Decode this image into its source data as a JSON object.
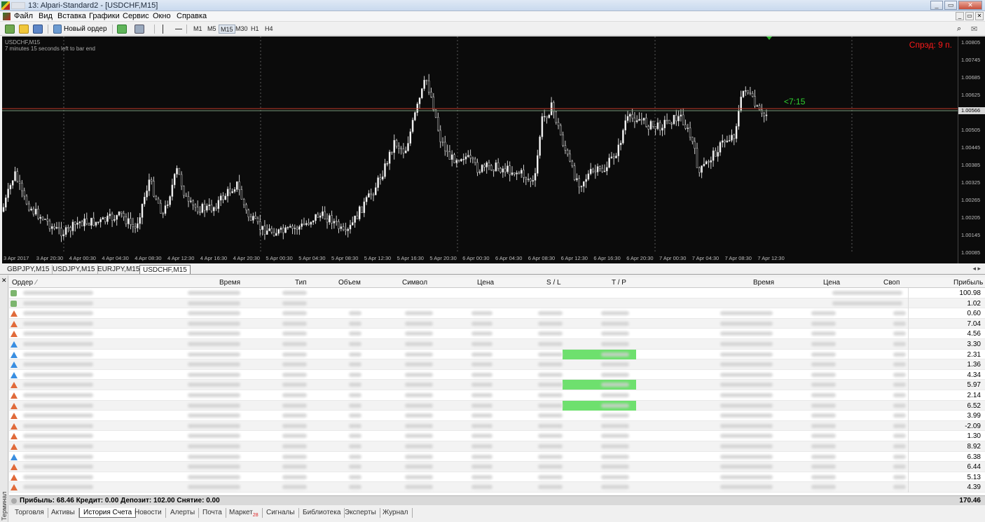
{
  "window": {
    "title": "13: Alpari-Standard2 - [USDCHF,M15]",
    "controls": [
      "_",
      "▭",
      "✕"
    ],
    "mdi_controls": [
      "_",
      "▭",
      "✕"
    ]
  },
  "menu": [
    "Файл",
    "Вид",
    "Вставка",
    "Графики",
    "Сервис",
    "Окно",
    "Справка"
  ],
  "toolbar": {
    "new_order_label": "Новый ордер",
    "timeframes": [
      "M1",
      "M5",
      "M15",
      "M30",
      "H1",
      "H4"
    ],
    "active_timeframe": "M15"
  },
  "chart": {
    "symbol_label": "USDCHF,M15",
    "timer_text": "7 minutes 15 seconds left to bar end",
    "spread_text": "Спрэд: 9 п.",
    "countdown_text": "<7:15",
    "current_price": "1.00566",
    "price_ticks": [
      "1.00805",
      "1.00745",
      "1.00685",
      "1.00625",
      "1.00566",
      "1.00505",
      "1.00445",
      "1.00385",
      "1.00325",
      "1.00265",
      "1.00205",
      "1.00145",
      "1.00085"
    ],
    "time_ticks": [
      "3 Apr 2017",
      "3 Apr 20:30",
      "4 Apr 00:30",
      "4 Apr 04:30",
      "4 Apr 08:30",
      "4 Apr 12:30",
      "4 Apr 16:30",
      "4 Apr 20:30",
      "5 Apr 00:30",
      "5 Apr 04:30",
      "5 Apr 08:30",
      "5 Apr 12:30",
      "5 Apr 16:30",
      "5 Apr 20:30",
      "6 Apr 00:30",
      "6 Apr 04:30",
      "6 Apr 08:30",
      "6 Apr 12:30",
      "6 Apr 16:30",
      "6 Apr 20:30",
      "7 Apr 00:30",
      "7 Apr 04:30",
      "7 Apr 08:30",
      "7 Apr 12:30"
    ],
    "colors": {
      "background": "#0b0b0b",
      "candles": "#d0d0d0",
      "spread": "#ff1a1a",
      "countdown": "#2fd12f"
    }
  },
  "chart_tabs": [
    "GBPJPY,M15",
    "USDJPY,M15",
    "EURJPY,M15",
    "USDCHF,M15"
  ],
  "active_chart_tab": "USDCHF,M15",
  "terminal": {
    "side_label": "Терминал",
    "columns": [
      "Ордер",
      "Время",
      "Тип",
      "Объем",
      "Символ",
      "Цена",
      "S / L",
      "T / P",
      "Время",
      "Цена",
      "Своп",
      "Прибыль"
    ],
    "rows": [
      {
        "type": "balance",
        "profit": "100.98"
      },
      {
        "type": "balance",
        "profit": "1.02"
      },
      {
        "type": "sell",
        "profit": "0.60"
      },
      {
        "type": "sell",
        "profit": "7.04"
      },
      {
        "type": "sell",
        "profit": "4.56"
      },
      {
        "type": "buy",
        "profit": "3.30"
      },
      {
        "type": "buy",
        "profit": "2.31",
        "tp_hit": true
      },
      {
        "type": "buy",
        "profit": "1.36"
      },
      {
        "type": "buy",
        "profit": "4.34"
      },
      {
        "type": "sell",
        "profit": "5.97",
        "tp_hit": true
      },
      {
        "type": "sell",
        "profit": "2.14"
      },
      {
        "type": "sell",
        "profit": "6.52",
        "tp_hit": true
      },
      {
        "type": "sell",
        "profit": "3.99"
      },
      {
        "type": "sell",
        "profit": "-2.09"
      },
      {
        "type": "sell",
        "profit": "1.30"
      },
      {
        "type": "sell",
        "profit": "8.92"
      },
      {
        "type": "buy",
        "profit": "6.38"
      },
      {
        "type": "sell",
        "profit": "6.44"
      },
      {
        "type": "sell",
        "profit": "5.13"
      },
      {
        "type": "sell",
        "profit": "4.39"
      }
    ],
    "summary_text": "Прибыль: 68.46  Кредит: 0.00  Депозит: 102.00  Снятие: 0.00",
    "summary_total": "170.46"
  },
  "bottom_tabs": [
    {
      "label": "Торговля"
    },
    {
      "label": "Активы"
    },
    {
      "label": "История Счета",
      "active": true
    },
    {
      "label": "Новости"
    },
    {
      "label": "Алерты"
    },
    {
      "label": "Почта"
    },
    {
      "label": "Маркет",
      "badge": "28"
    },
    {
      "label": "Сигналы"
    },
    {
      "label": "Библиотека"
    },
    {
      "label": "Эксперты"
    },
    {
      "label": "Журнал"
    }
  ]
}
